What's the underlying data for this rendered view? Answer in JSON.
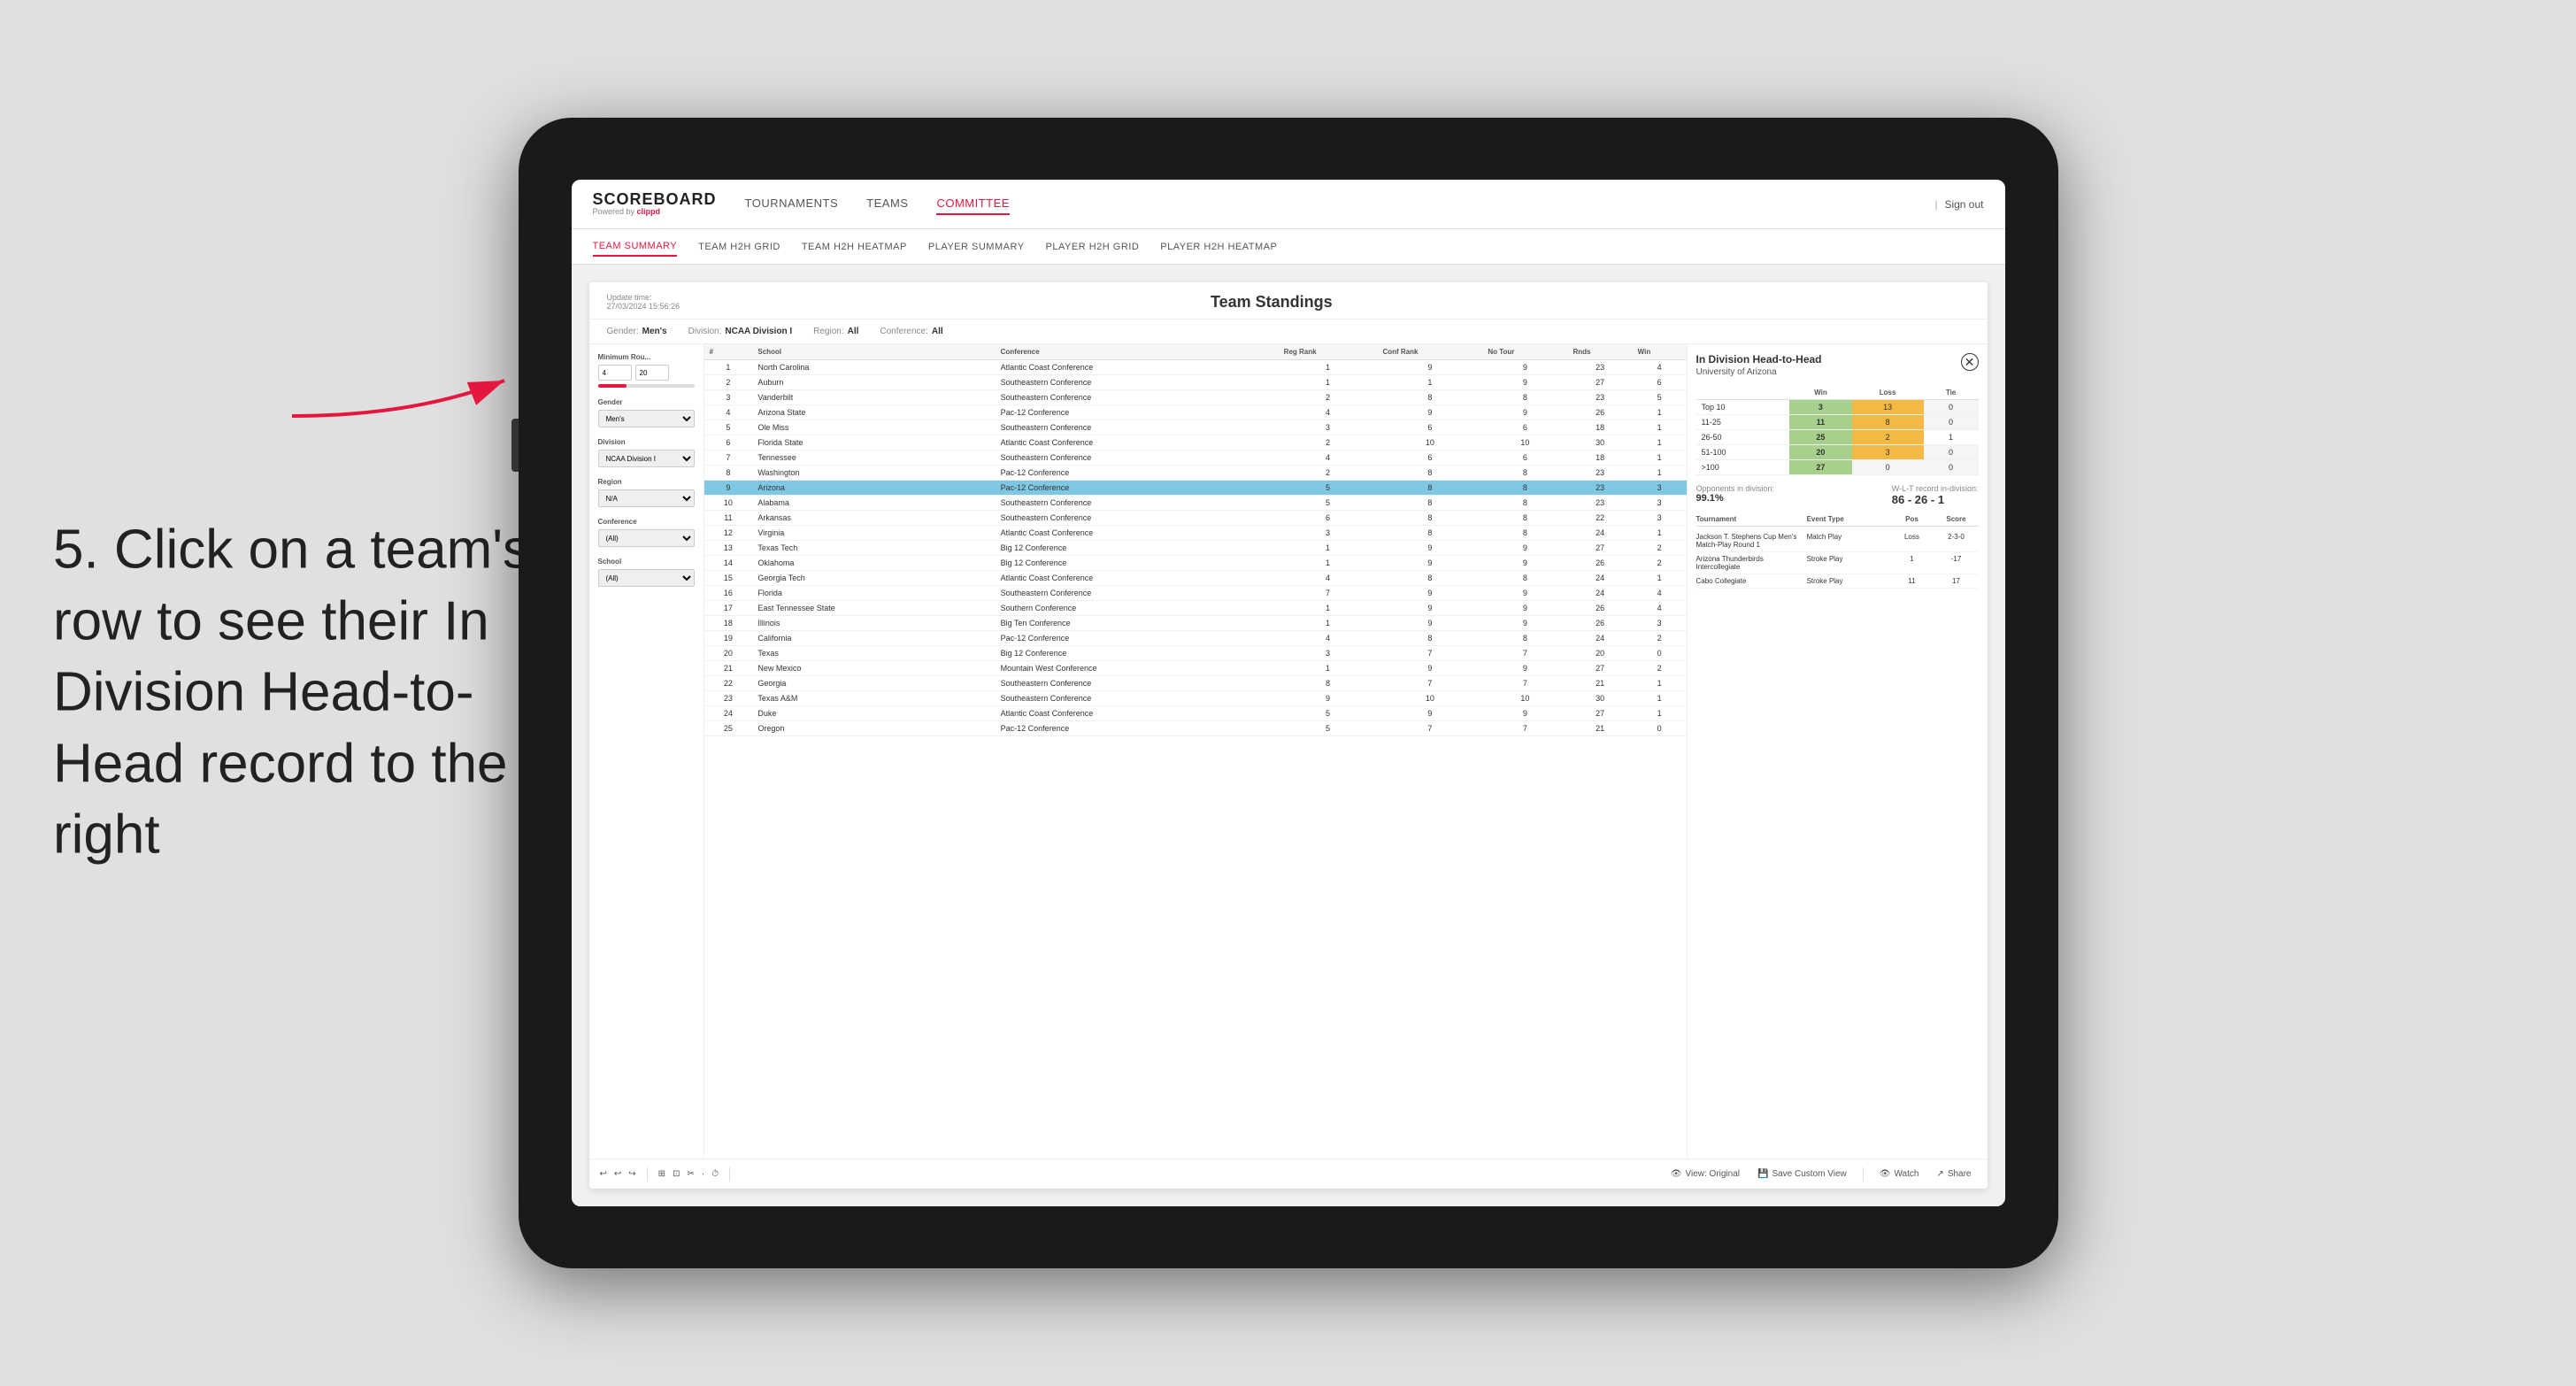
{
  "app": {
    "logo": "SCOREBOARD",
    "logo_sub": "Powered by clippd",
    "sign_out_sep": "|",
    "sign_out": "Sign out"
  },
  "nav": {
    "items": [
      {
        "label": "TOURNAMENTS",
        "active": false
      },
      {
        "label": "TEAMS",
        "active": false
      },
      {
        "label": "COMMITTEE",
        "active": true
      }
    ]
  },
  "subnav": {
    "items": [
      {
        "label": "TEAM SUMMARY",
        "active": true
      },
      {
        "label": "TEAM H2H GRID",
        "active": false
      },
      {
        "label": "TEAM H2H HEATMAP",
        "active": false
      },
      {
        "label": "PLAYER SUMMARY",
        "active": false
      },
      {
        "label": "PLAYER H2H GRID",
        "active": false
      },
      {
        "label": "PLAYER H2H HEATMAP",
        "active": false
      }
    ]
  },
  "instruction": {
    "text": "5. Click on a team's row to see their In Division Head-to-Head record to the right"
  },
  "panel": {
    "update_time_label": "Update time:",
    "update_time": "27/03/2024 15:56:26",
    "title": "Team Standings",
    "filter_gender_label": "Gender:",
    "filter_gender": "Men's",
    "filter_division_label": "Division:",
    "filter_division": "NCAA Division I",
    "filter_region_label": "Region:",
    "filter_region": "All",
    "filter_conference_label": "Conference:",
    "filter_conference": "All"
  },
  "filters": {
    "min_rounds_label": "Minimum Rou...",
    "min_rounds_min": "4",
    "min_rounds_max": "20",
    "gender_label": "Gender",
    "gender_value": "Men's",
    "division_label": "Division",
    "division_value": "NCAA Division I",
    "region_label": "Region",
    "region_value": "N/A",
    "conference_label": "Conference",
    "conference_value": "(All)",
    "school_label": "School",
    "school_value": "(All)"
  },
  "table": {
    "headers": [
      "#",
      "School",
      "Conference",
      "Reg Rank",
      "Conf Rank",
      "No Tour",
      "Rnds",
      "Win"
    ],
    "rows": [
      {
        "rank": 1,
        "school": "North Carolina",
        "conference": "Atlantic Coast Conference",
        "reg_rank": 1,
        "conf_rank": 9,
        "no_tour": 9,
        "rnds": 23,
        "win": 4
      },
      {
        "rank": 2,
        "school": "Auburn",
        "conference": "Southeastern Conference",
        "reg_rank": 1,
        "conf_rank": 1,
        "no_tour": 9,
        "rnds": 27,
        "win": 6
      },
      {
        "rank": 3,
        "school": "Vanderbilt",
        "conference": "Southeastern Conference",
        "reg_rank": 2,
        "conf_rank": 8,
        "no_tour": 8,
        "rnds": 23,
        "win": 5
      },
      {
        "rank": 4,
        "school": "Arizona State",
        "conference": "Pac-12 Conference",
        "reg_rank": 4,
        "conf_rank": 9,
        "no_tour": 9,
        "rnds": 26,
        "win": 1
      },
      {
        "rank": 5,
        "school": "Ole Miss",
        "conference": "Southeastern Conference",
        "reg_rank": 3,
        "conf_rank": 6,
        "no_tour": 6,
        "rnds": 18,
        "win": 1
      },
      {
        "rank": 6,
        "school": "Florida State",
        "conference": "Atlantic Coast Conference",
        "reg_rank": 2,
        "conf_rank": 10,
        "no_tour": 10,
        "rnds": 30,
        "win": 1
      },
      {
        "rank": 7,
        "school": "Tennessee",
        "conference": "Southeastern Conference",
        "reg_rank": 4,
        "conf_rank": 6,
        "no_tour": 6,
        "rnds": 18,
        "win": 1
      },
      {
        "rank": 8,
        "school": "Washington",
        "conference": "Pac-12 Conference",
        "reg_rank": 2,
        "conf_rank": 8,
        "no_tour": 8,
        "rnds": 23,
        "win": 1
      },
      {
        "rank": 9,
        "school": "Arizona",
        "conference": "Pac-12 Conference",
        "reg_rank": 5,
        "conf_rank": 8,
        "no_tour": 8,
        "rnds": 23,
        "win": 3,
        "highlighted": true
      },
      {
        "rank": 10,
        "school": "Alabama",
        "conference": "Southeastern Conference",
        "reg_rank": 5,
        "conf_rank": 8,
        "no_tour": 8,
        "rnds": 23,
        "win": 3
      },
      {
        "rank": 11,
        "school": "Arkansas",
        "conference": "Southeastern Conference",
        "reg_rank": 6,
        "conf_rank": 8,
        "no_tour": 8,
        "rnds": 22,
        "win": 3
      },
      {
        "rank": 12,
        "school": "Virginia",
        "conference": "Atlantic Coast Conference",
        "reg_rank": 3,
        "conf_rank": 8,
        "no_tour": 8,
        "rnds": 24,
        "win": 1
      },
      {
        "rank": 13,
        "school": "Texas Tech",
        "conference": "Big 12 Conference",
        "reg_rank": 1,
        "conf_rank": 9,
        "no_tour": 9,
        "rnds": 27,
        "win": 2
      },
      {
        "rank": 14,
        "school": "Oklahoma",
        "conference": "Big 12 Conference",
        "reg_rank": 1,
        "conf_rank": 9,
        "no_tour": 9,
        "rnds": 26,
        "win": 2
      },
      {
        "rank": 15,
        "school": "Georgia Tech",
        "conference": "Atlantic Coast Conference",
        "reg_rank": 4,
        "conf_rank": 8,
        "no_tour": 8,
        "rnds": 24,
        "win": 1
      },
      {
        "rank": 16,
        "school": "Florida",
        "conference": "Southeastern Conference",
        "reg_rank": 7,
        "conf_rank": 9,
        "no_tour": 9,
        "rnds": 24,
        "win": 4
      },
      {
        "rank": 17,
        "school": "East Tennessee State",
        "conference": "Southern Conference",
        "reg_rank": 1,
        "conf_rank": 9,
        "no_tour": 9,
        "rnds": 26,
        "win": 4
      },
      {
        "rank": 18,
        "school": "Illinois",
        "conference": "Big Ten Conference",
        "reg_rank": 1,
        "conf_rank": 9,
        "no_tour": 9,
        "rnds": 26,
        "win": 3
      },
      {
        "rank": 19,
        "school": "California",
        "conference": "Pac-12 Conference",
        "reg_rank": 4,
        "conf_rank": 8,
        "no_tour": 8,
        "rnds": 24,
        "win": 2
      },
      {
        "rank": 20,
        "school": "Texas",
        "conference": "Big 12 Conference",
        "reg_rank": 3,
        "conf_rank": 7,
        "no_tour": 7,
        "rnds": 20,
        "win": 0
      },
      {
        "rank": 21,
        "school": "New Mexico",
        "conference": "Mountain West Conference",
        "reg_rank": 1,
        "conf_rank": 9,
        "no_tour": 9,
        "rnds": 27,
        "win": 2
      },
      {
        "rank": 22,
        "school": "Georgia",
        "conference": "Southeastern Conference",
        "reg_rank": 8,
        "conf_rank": 7,
        "no_tour": 7,
        "rnds": 21,
        "win": 1
      },
      {
        "rank": 23,
        "school": "Texas A&M",
        "conference": "Southeastern Conference",
        "reg_rank": 9,
        "conf_rank": 10,
        "no_tour": 10,
        "rnds": 30,
        "win": 1
      },
      {
        "rank": 24,
        "school": "Duke",
        "conference": "Atlantic Coast Conference",
        "reg_rank": 5,
        "conf_rank": 9,
        "no_tour": 9,
        "rnds": 27,
        "win": 1
      },
      {
        "rank": 25,
        "school": "Oregon",
        "conference": "Pac-12 Conference",
        "reg_rank": 5,
        "conf_rank": 7,
        "no_tour": 7,
        "rnds": 21,
        "win": 0
      }
    ]
  },
  "h2h": {
    "title": "In Division Head-to-Head",
    "team": "University of Arizona",
    "col_win": "Win",
    "col_loss": "Loss",
    "col_tie": "Tie",
    "rows": [
      {
        "label": "Top 10",
        "win": 3,
        "loss": 13,
        "tie": 0,
        "win_color": "green",
        "loss_color": "orange"
      },
      {
        "label": "11-25",
        "win": 11,
        "loss": 8,
        "tie": 0,
        "win_color": "green"
      },
      {
        "label": "26-50",
        "win": 25,
        "loss": 2,
        "tie": 1,
        "win_color": "green"
      },
      {
        "label": "51-100",
        "win": 20,
        "loss": 3,
        "tie": 0,
        "win_color": "green"
      },
      {
        "label": ">100",
        "win": 27,
        "loss": 0,
        "tie": 0,
        "win_color": "green"
      }
    ],
    "opponents_label": "Opponents in division:",
    "opponents_pct": "99.1%",
    "record_label": "W-L-T record in-division:",
    "record": "86 - 26 - 1",
    "tournament_headers": [
      "Tournament",
      "Event Type",
      "Pos",
      "Score"
    ],
    "tournaments": [
      {
        "name": "Jackson T. Stephens Cup Men's Match-Play Round 1",
        "type": "Match Play",
        "result": "Loss",
        "score": "2-3-0"
      },
      {
        "name": "Arizona Thunderbirds Intercollegiate",
        "type": "Stroke Play",
        "result": "1",
        "score": "-17"
      },
      {
        "name": "Cabo Collegiate",
        "type": "Stroke Play",
        "result": "11",
        "score": "17"
      }
    ]
  },
  "toolbar": {
    "undo": "↩",
    "redo": "↪",
    "icons": [
      "⟳",
      "◀",
      "▶",
      "☁",
      "⊞",
      "·",
      "⏱"
    ],
    "view_original": "View: Original",
    "save_custom": "Save Custom View",
    "watch": "Watch",
    "share": "Share"
  }
}
